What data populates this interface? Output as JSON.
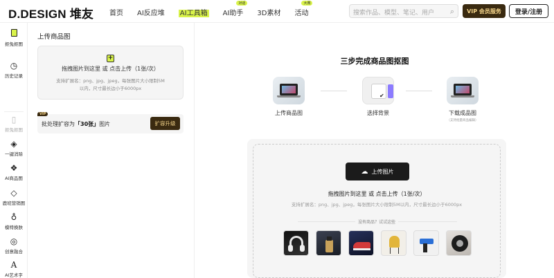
{
  "header": {
    "logo": "D.DESIGN 堆友",
    "nav": [
      {
        "label": "首页",
        "tag": ""
      },
      {
        "label": "AI反应堆",
        "tag": ""
      },
      {
        "label": "AI工具箱",
        "tag": ""
      },
      {
        "label": "AI助手",
        "tag": "对话"
      },
      {
        "label": "3D素材",
        "tag": ""
      },
      {
        "label": "活动",
        "tag": "大赛"
      }
    ],
    "search_placeholder": "搜索作品、模型、笔记、用户",
    "vip_label": "VIP 会员服务",
    "login_label": "登录/注册"
  },
  "sidebar": {
    "items": [
      {
        "label": "抠兔抠图",
        "icon": "cutout-icon"
      },
      {
        "label": "历史记录",
        "icon": "clock-icon"
      },
      {
        "label": "抠兔抠图",
        "icon": "book-icon"
      },
      {
        "label": "一键消除",
        "icon": "eraser-icon"
      },
      {
        "label": "AI商品图",
        "icon": "diamond-icon"
      },
      {
        "label": "鹿班营销图",
        "icon": "layers-icon"
      },
      {
        "label": "模特换肤",
        "icon": "bulb-icon"
      },
      {
        "label": "创意融合",
        "icon": "rings-icon"
      },
      {
        "label": "AI艺术字",
        "icon": "letter-a-icon"
      }
    ]
  },
  "left_panel": {
    "title": "上传商品图",
    "upload_main": "拖拽图片到这里 或 点击上传（1张/次）",
    "upload_sub1": "支持扩展名：png、jpg、jpeg，每张图片大小限制5M",
    "upload_sub2": "以内，尺寸最长边小于6000px",
    "vip_tag": "VIP",
    "batch_prefix": "批处理扩容为",
    "batch_value": "「30张」",
    "batch_suffix": "图片",
    "expand_label": "扩容升级"
  },
  "main": {
    "title": "三步完成商品图抠图",
    "steps": [
      {
        "label": "上传商品图",
        "sub": ""
      },
      {
        "label": "选择背景",
        "sub": ""
      },
      {
        "label": "下载成品图",
        "sub": "（支持批量商品编辑）"
      }
    ],
    "upload_button": "上传图片",
    "upload_main": "拖拽图片到这里 或 点击上传（1张/次）",
    "upload_sub": "支持扩展名：png、jpg、jpeg，每张图片大小限制5M以内，尺寸最长边小于6000px",
    "try_text": "没有商品？试试这些",
    "samples": [
      {
        "name": "headphones",
        "color1": "#111111",
        "color2": "#555555"
      },
      {
        "name": "perfume",
        "color1": "#2a2f3a",
        "color2": "#c9a25a"
      },
      {
        "name": "sneaker",
        "color1": "#1a2240",
        "color2": "#d23a3a"
      },
      {
        "name": "chair",
        "color1": "#f2efe8",
        "color2": "#e2b53a"
      },
      {
        "name": "drill",
        "color1": "#f1f1f1",
        "color2": "#2a6fd6"
      },
      {
        "name": "tire",
        "color1": "#d8d4cf",
        "color2": "#1d1d1d"
      }
    ]
  }
}
